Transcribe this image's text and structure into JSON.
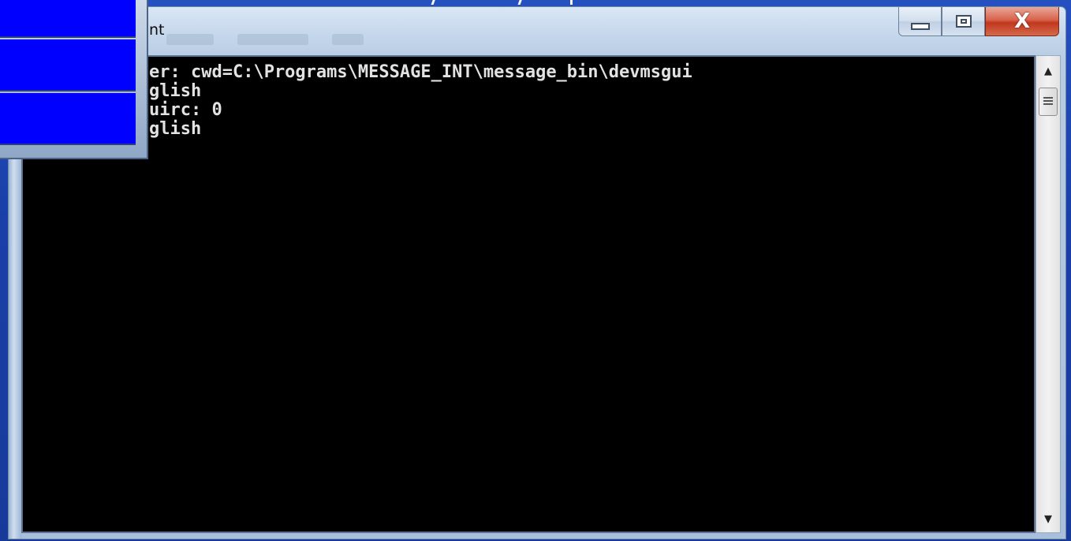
{
  "top_overlay": {
    "marks": [
      "/",
      "/",
      "|"
    ]
  },
  "side_panel": {
    "items": [
      {
        "label": ""
      },
      {
        "label": ""
      },
      {
        "label": ""
      }
    ]
  },
  "window": {
    "title": "nt",
    "caption_buttons": {
      "minimize": "minimize",
      "maximize": "maximize",
      "close": "X"
    }
  },
  "console": {
    "lines": [
      "er: cwd=C:\\Programs\\MESSAGE_INT\\message_bin\\devmsgui",
      "glish",
      "uirc: 0",
      "glish"
    ],
    "background": "#000000",
    "text_color": "#e2e2e2"
  },
  "colors": {
    "panel_blue": "#0000ff",
    "desktop": "#1a3fa8",
    "close_red": "#c2371e"
  }
}
